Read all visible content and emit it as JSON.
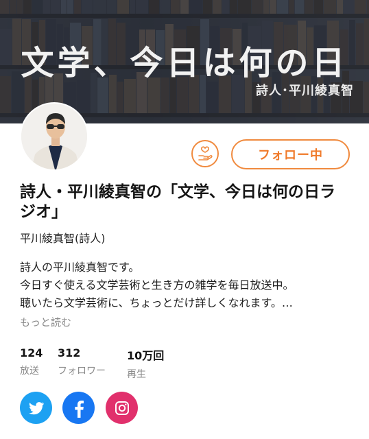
{
  "banner": {
    "title": "文学、今日は何の日",
    "subtitle": "詩人･平川綾真智"
  },
  "actions": {
    "support_icon": "hand-heart-icon",
    "follow_label": "フォロー中"
  },
  "channel": {
    "title": "詩人・平川綾真智の「文学、今日は何の日ラジオ」",
    "author": "平川綾真智(詩人)",
    "description_lines": [
      "詩人の平川綾真智です。",
      "今日すぐ使える文学芸術と生き方の雑学を毎日放送中。",
      "聴いたら文学芸術に、ちょっとだけ詳しくなれます。…"
    ],
    "more_label": "もっと読む"
  },
  "stats": [
    {
      "value": "124",
      "label": "放送"
    },
    {
      "value": "312",
      "label": "フォロワー"
    },
    {
      "value": "10万回",
      "label": "再生"
    }
  ],
  "social": [
    {
      "icon": "twitter-icon",
      "color": "#1da1f2"
    },
    {
      "icon": "facebook-icon",
      "color": "#1877f2"
    },
    {
      "icon": "instagram-icon",
      "color": "#e1306c"
    }
  ],
  "colors": {
    "accent": "#f08a3e"
  }
}
